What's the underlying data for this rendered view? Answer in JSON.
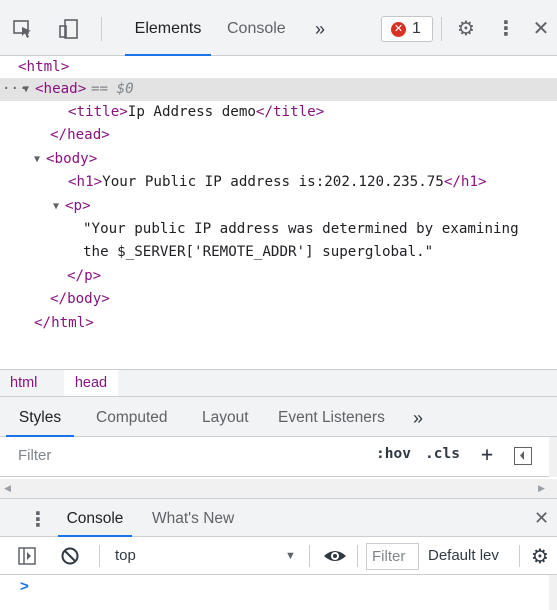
{
  "toolbar": {
    "tabs": [
      "Elements",
      "Console"
    ],
    "more_label": "»",
    "error_count": "1",
    "icons": [
      "inspect-icon",
      "device-toggle-icon",
      "gear-icon",
      "kebab-menu-icon",
      "close-icon"
    ]
  },
  "tree": {
    "line0": {
      "open": "<html>"
    },
    "line1": {
      "dots": "···",
      "tri": "▼",
      "tag": "<head>",
      "marker": " == $0"
    },
    "line2": {
      "open": "<title>",
      "text": "Ip Address demo",
      "close": "</title>"
    },
    "line3": {
      "close": "</head>"
    },
    "line4": {
      "tri": "▼",
      "tag": "<body>"
    },
    "line5": {
      "open": "<h1>",
      "text": "Your Public IP address is:202.120.235.75",
      "close": "</h1>"
    },
    "line6": {
      "tri": "▼",
      "tag": "<p>"
    },
    "line7": {
      "text": "\"Your public IP address was determined by examining"
    },
    "line8": {
      "text": "the $_SERVER['REMOTE_ADDR'] superglobal.\""
    },
    "line9": {
      "close": "</p>"
    },
    "line10": {
      "close": "</body>"
    },
    "line11": {
      "close": "</html>"
    }
  },
  "breadcrumbs": [
    "html",
    "head"
  ],
  "styles_tabs": [
    "Styles",
    "Computed",
    "Layout",
    "Event Listeners"
  ],
  "styles_more": "»",
  "styles_filter": {
    "placeholder": "Filter",
    "hov": ":hov",
    "cls": ".cls",
    "plus": "+"
  },
  "drawer": {
    "tabs": [
      "Console",
      "What's New"
    ]
  },
  "console_toolbar": {
    "context": "top",
    "filter_placeholder": "Filter",
    "levels": "Default lev"
  },
  "prompt": ">",
  "colors": {
    "accent": "#1a73e8",
    "tag": "#881280",
    "error": "#d93025"
  }
}
